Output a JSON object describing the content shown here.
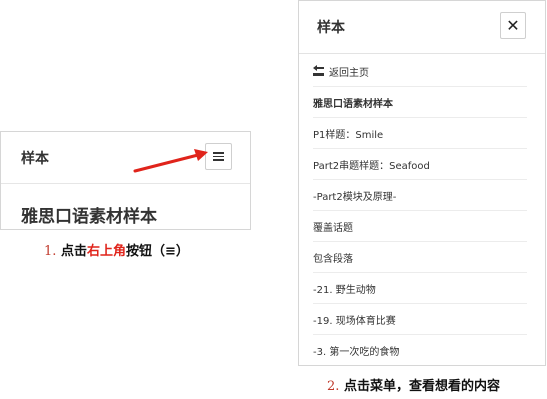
{
  "mock": {
    "brand": "样本",
    "menu_icon": "hamburger-menu-icon",
    "title": "雅思口语素材样本"
  },
  "arrow_color": "#e0241b",
  "step1": {
    "number": "1.",
    "prefix": "点击",
    "highlight": "右上角",
    "suffix": "按钮（≡）"
  },
  "panel": {
    "brand": "样本",
    "close_label": "✕",
    "items": [
      {
        "label": "返回主页",
        "icon": "back-icon"
      },
      {
        "label": "雅思口语素材样本"
      },
      {
        "label": "P1样题：Smile"
      },
      {
        "label": "Part2串题样题：Seafood"
      },
      {
        "label": "-Part2模块及原理-"
      },
      {
        "label": "覆盖话题"
      },
      {
        "label": "包含段落"
      },
      {
        "label": "-21. 野生动物"
      },
      {
        "label": "-19. 现场体育比赛"
      },
      {
        "label": "-3. 第一次吃的食物"
      }
    ]
  },
  "step2": {
    "number": "2.",
    "text": "点击菜单，查看想看的内容"
  },
  "colors": {
    "highlight": "#e0241b",
    "step_number": "#c0392b",
    "border": "#d6d6d6"
  }
}
